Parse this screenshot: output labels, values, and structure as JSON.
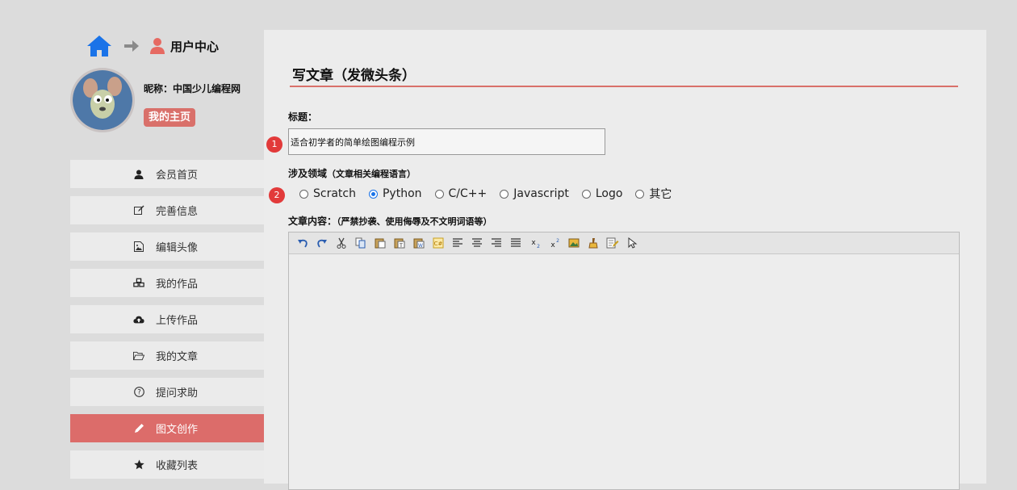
{
  "sidebar": {
    "breadcrumb_title": "用户中心",
    "nickname": "昵称：中国少儿编程网",
    "home_button": "我的主页",
    "menu": [
      {
        "label": "会员首页",
        "icon": "user-icon",
        "active": false
      },
      {
        "label": "完善信息",
        "icon": "edit-icon",
        "active": false
      },
      {
        "label": "编辑头像",
        "icon": "image-icon",
        "active": false
      },
      {
        "label": "我的作品",
        "icon": "cubes-icon",
        "active": false
      },
      {
        "label": "上传作品",
        "icon": "cloud-upload-icon",
        "active": false
      },
      {
        "label": "我的文章",
        "icon": "folder-open-icon",
        "active": false
      },
      {
        "label": "提问求助",
        "icon": "question-icon",
        "active": false
      },
      {
        "label": "图文创作",
        "icon": "pencil-icon",
        "active": true
      },
      {
        "label": "收藏列表",
        "icon": "star-icon",
        "active": false
      }
    ]
  },
  "main": {
    "page_title": "写文章（发微头条）",
    "title_label": "标题：",
    "title_value": "适合初学者的简单绘图编程示例",
    "badge_1": "1",
    "badge_2": "2",
    "domain_label": "涉及领域",
    "domain_hint": "（文章相关编程语言）",
    "domains": [
      {
        "label": "Scratch",
        "checked": false
      },
      {
        "label": "Python",
        "checked": true
      },
      {
        "label": "C/C++",
        "checked": false
      },
      {
        "label": "Javascript",
        "checked": false
      },
      {
        "label": "Logo",
        "checked": false
      },
      {
        "label": "其它",
        "checked": false
      }
    ],
    "content_label": "文章内容：",
    "content_hint": "（严禁抄袭、使用侮辱及不文明词语等）",
    "toolbar_icons": [
      "undo-icon",
      "redo-icon",
      "cut-icon",
      "copy-icon",
      "paste-icon",
      "paste-text-icon",
      "paste-word-icon",
      "code-icon",
      "align-left-icon",
      "align-center-icon",
      "align-right-icon",
      "justify-icon",
      "subscript-icon",
      "superscript-icon",
      "insert-image-icon",
      "clear-format-icon",
      "edit-source-icon",
      "select-icon"
    ]
  },
  "colors": {
    "accent": "#d9706a",
    "active_menu": "#dc6c6a",
    "badge": "#e23a3a",
    "home_icon": "#1a73e8"
  }
}
